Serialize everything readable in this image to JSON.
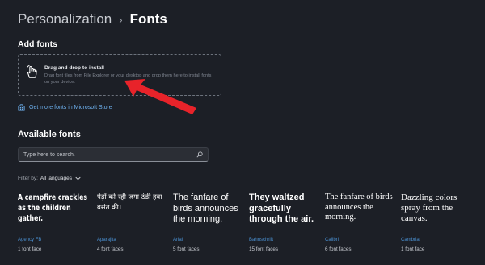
{
  "header": {
    "breadcrumb_parent": "Personalization",
    "separator": "›",
    "breadcrumb_current": "Fonts"
  },
  "add_fonts": {
    "title": "Add fonts",
    "drop_title": "Drag and drop to install",
    "drop_description": "Drag font files from File Explorer or your desktop and drop them here to install fonts on your device.",
    "hand_icon": "hand-drag-icon"
  },
  "store_link": {
    "label": "Get more fonts in Microsoft Store",
    "icon": "store-icon"
  },
  "available": {
    "title": "Available fonts",
    "search_placeholder": "Type here to search.",
    "filter_label": "Filter by:",
    "filter_value": "All languages"
  },
  "fonts": [
    {
      "sample": "A campfire crackles as the children gather.",
      "name": "Agency FB",
      "faces": "1 font face"
    },
    {
      "sample": "पेड़ों को रही जगा ठंडी हवा बसंत की।",
      "name": "Aparajita",
      "faces": "4 font faces"
    },
    {
      "sample": "The fanfare of birds announces the morning.",
      "name": "Arial",
      "faces": "5 font faces"
    },
    {
      "sample": "They waltzed gracefully through the air.",
      "name": "Bahnschrift",
      "faces": "15 font faces"
    },
    {
      "sample": "The fanfare of birds announces the morning.",
      "name": "Calibri",
      "faces": "6 font faces"
    },
    {
      "sample": "Dazzling colors spray from the canvas.",
      "name": "Cambria",
      "faces": "1 font face"
    }
  ],
  "colors": {
    "background": "#1c1f26",
    "accent_link": "#6fb3f2",
    "annotation_arrow": "#e8232a"
  }
}
